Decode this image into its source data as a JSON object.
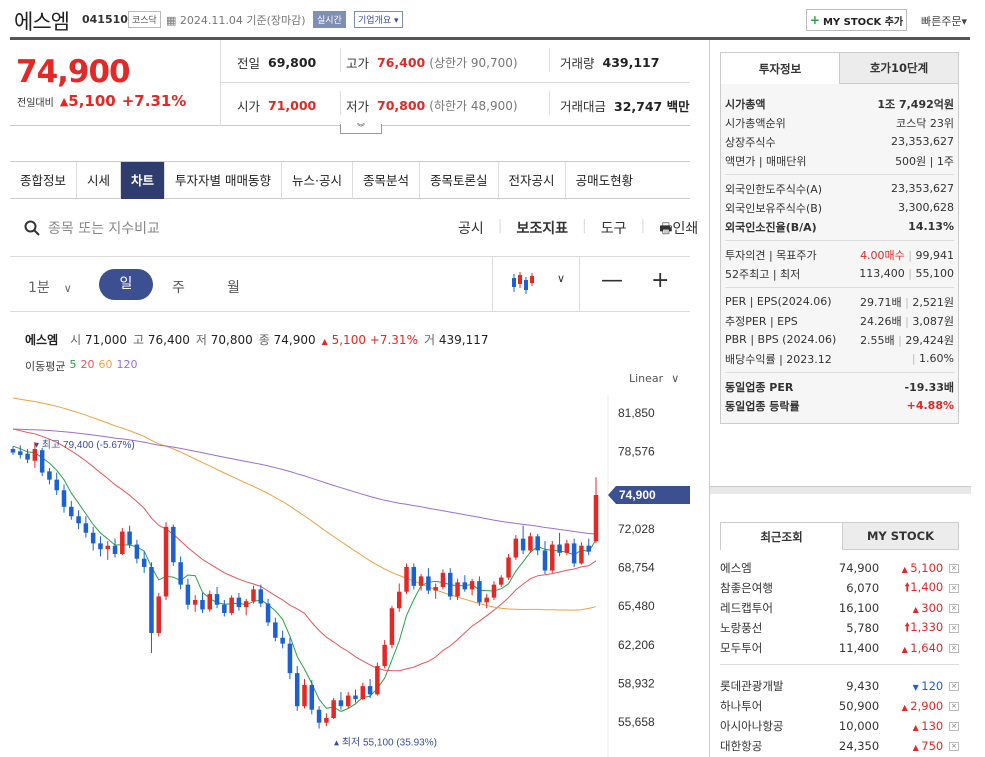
{
  "header": {
    "title": "에스엠",
    "code": "041510",
    "market": "코스닥",
    "date": "2024.11.04",
    "basis": "기준(장마감)",
    "realtime": "실시간",
    "overview": "기업개요",
    "mystock_btn": "MY STOCK 추가",
    "quick_order": "빠른주문"
  },
  "price": {
    "current": "74,900",
    "change_label": "전일대비",
    "change": "5,100",
    "change_pct": "+7.31%"
  },
  "quote": {
    "prev_label": "전일",
    "prev": "69,800",
    "high_label": "고가",
    "high": "76,400",
    "upper_limit": "(상한가 90,700)",
    "volume_label": "거래량",
    "volume": "439,117",
    "open_label": "시가",
    "open": "71,000",
    "low_label": "저가",
    "low": "70,800",
    "lower_limit": "(하한가 48,900)",
    "amount_label": "거래대금",
    "amount": "32,747 백만"
  },
  "tabs": [
    "종합정보",
    "시세",
    "차트",
    "투자자별 매매동향",
    "뉴스·공시",
    "종목분석",
    "종목토론실",
    "전자공시",
    "공매도현황"
  ],
  "search": {
    "placeholder": "종목 또는 지수비교"
  },
  "tools": {
    "disclosure": "공시",
    "indicator": "보조지표",
    "tool": "도구",
    "print": "인쇄"
  },
  "period": {
    "minute": "1분",
    "day": "일",
    "week": "주",
    "month": "월"
  },
  "ohlc": {
    "name": "에스엠",
    "open_l": "시",
    "open": "71,000",
    "high_l": "고",
    "high": "76,400",
    "low_l": "저",
    "low": "70,800",
    "close_l": "종",
    "close": "74,900",
    "change": "5,100",
    "pct": "+7.31%",
    "vol_l": "거",
    "vol": "439,117"
  },
  "ma": {
    "label": "이동평균",
    "p5": "5",
    "p20": "20",
    "p60": "60",
    "p120": "120",
    "c5": "#2aa14a",
    "c20": "#e8555a",
    "c60": "#f0a040",
    "c120": "#9b6fd6"
  },
  "chart_data": {
    "type": "candlestick",
    "scale": "Linear",
    "y_ticks": [
      81850,
      78576,
      75302,
      72028,
      68754,
      65480,
      62206,
      58932,
      55658
    ],
    "y_tick_labels": [
      "81,850",
      "78,576",
      "",
      "72,028",
      "68,754",
      "65,480",
      "62,206",
      "58,932",
      "55,658"
    ],
    "current_label": "74,900",
    "high_note": "최고 79,400 (-5.67%)",
    "low_note": "최저 55,100 (35.93%)",
    "candles": [
      [
        78800,
        79000,
        78300,
        78500
      ],
      [
        78600,
        79100,
        78000,
        78300
      ],
      [
        78400,
        78800,
        77600,
        77900
      ],
      [
        77800,
        79400,
        77200,
        78800
      ],
      [
        78700,
        78900,
        76500,
        76800
      ],
      [
        76900,
        77200,
        75800,
        76200
      ],
      [
        76200,
        76800,
        74900,
        75300
      ],
      [
        75300,
        75800,
        73400,
        73900
      ],
      [
        73900,
        74400,
        72800,
        73100
      ],
      [
        73100,
        73600,
        72000,
        72500
      ],
      [
        72500,
        73100,
        71300,
        71700
      ],
      [
        71700,
        72200,
        70200,
        70800
      ],
      [
        70800,
        71400,
        69700,
        70300
      ],
      [
        70300,
        71000,
        69400,
        70600
      ],
      [
        70600,
        71200,
        69600,
        69900
      ],
      [
        69900,
        72100,
        69800,
        71800
      ],
      [
        71800,
        72300,
        70400,
        70700
      ],
      [
        70700,
        71100,
        69100,
        69500
      ],
      [
        69500,
        70100,
        68300,
        68800
      ],
      [
        68800,
        69200,
        61500,
        63200
      ],
      [
        63200,
        66600,
        62900,
        66300
      ],
      [
        66300,
        72600,
        66000,
        72200
      ],
      [
        72200,
        72400,
        68900,
        69200
      ],
      [
        69200,
        69700,
        66900,
        67300
      ],
      [
        67300,
        67800,
        65200,
        65600
      ],
      [
        65600,
        66400,
        65000,
        66000
      ],
      [
        66000,
        66600,
        64900,
        65200
      ],
      [
        65200,
        66800,
        65000,
        66500
      ],
      [
        66500,
        67100,
        65300,
        65600
      ],
      [
        65600,
        66000,
        64600,
        64900
      ],
      [
        64900,
        66400,
        64700,
        66200
      ],
      [
        66200,
        66600,
        65100,
        65400
      ],
      [
        65400,
        66100,
        64700,
        65900
      ],
      [
        65900,
        67200,
        65700,
        66900
      ],
      [
        66900,
        67300,
        65400,
        65700
      ],
      [
        65700,
        66100,
        63800,
        64100
      ],
      [
        64100,
        64500,
        62500,
        62800
      ],
      [
        62800,
        63400,
        61900,
        62300
      ],
      [
        62300,
        62800,
        59300,
        59800
      ],
      [
        59800,
        60400,
        56600,
        57000
      ],
      [
        57000,
        59300,
        56800,
        58800
      ],
      [
        58800,
        59200,
        56300,
        56700
      ],
      [
        56700,
        57000,
        55100,
        55600
      ],
      [
        55600,
        56400,
        55300,
        56000
      ],
      [
        56000,
        57700,
        55900,
        57500
      ],
      [
        57500,
        58200,
        56700,
        57000
      ],
      [
        57000,
        58200,
        56800,
        57900
      ],
      [
        57900,
        58400,
        57300,
        57600
      ],
      [
        57600,
        59000,
        57500,
        58700
      ],
      [
        58700,
        59300,
        57700,
        58000
      ],
      [
        58000,
        60700,
        57900,
        60400
      ],
      [
        60400,
        62600,
        60200,
        62200
      ],
      [
        62200,
        65500,
        61900,
        65300
      ],
      [
        65300,
        67400,
        65000,
        66700
      ],
      [
        66700,
        69100,
        66500,
        68800
      ],
      [
        68800,
        69100,
        66900,
        67200
      ],
      [
        67200,
        68200,
        66800,
        68000
      ],
      [
        68000,
        68700,
        66500,
        66800
      ],
      [
        66800,
        67400,
        66100,
        67100
      ],
      [
        67100,
        68600,
        66900,
        68300
      ],
      [
        68300,
        68700,
        66000,
        66300
      ],
      [
        66300,
        67800,
        66000,
        67500
      ],
      [
        67500,
        68100,
        66700,
        66900
      ],
      [
        66900,
        67800,
        66400,
        67600
      ],
      [
        67600,
        68000,
        65500,
        65800
      ],
      [
        65800,
        66500,
        65300,
        66200
      ],
      [
        66200,
        67600,
        66000,
        67300
      ],
      [
        67300,
        68100,
        67100,
        67900
      ],
      [
        67900,
        69900,
        67700,
        69600
      ],
      [
        69600,
        71500,
        69400,
        71200
      ],
      [
        71200,
        72300,
        69900,
        70200
      ],
      [
        70200,
        71700,
        70000,
        71400
      ],
      [
        71400,
        71600,
        69800,
        70200
      ],
      [
        70200,
        71000,
        68200,
        68500
      ],
      [
        68500,
        71000,
        68300,
        70700
      ],
      [
        70700,
        71700,
        69700,
        70000
      ],
      [
        70000,
        71100,
        69800,
        70800
      ],
      [
        70800,
        71200,
        68800,
        69100
      ],
      [
        69100,
        70900,
        69000,
        70600
      ],
      [
        70600,
        71200,
        69800,
        70100
      ],
      [
        71000,
        76400,
        70800,
        74900
      ]
    ]
  },
  "info_tabs": {
    "a": "투자정보",
    "b": "호가10단계"
  },
  "info": {
    "g1": [
      {
        "k": "시가총액",
        "v": "1조 7,492억원"
      },
      {
        "k": "시가총액순위",
        "v": "코스닥 23위"
      },
      {
        "k": "상장주식수",
        "v": "23,353,627"
      },
      {
        "k": "액면가 | 매매단위",
        "v": "500원 | 1주"
      }
    ],
    "g2": [
      {
        "k": "외국인한도주식수(A)",
        "v": "23,353,627"
      },
      {
        "k": "외국인보유주식수(B)",
        "v": "3,300,628"
      },
      {
        "k": "외국인소진율(B/A)",
        "v": "14.13%"
      }
    ],
    "g3": [
      {
        "k": "투자의견 | 목표주가",
        "v1": "4.00매수",
        "v2": "99,941"
      },
      {
        "k": "52주최고 | 최저",
        "v1": "113,400",
        "v2": "55,100"
      }
    ],
    "g4": [
      {
        "k": "PER | EPS(2024.06)",
        "v1": "29.71배",
        "v2": "2,521원"
      },
      {
        "k": "추정PER | EPS",
        "v1": "24.26배",
        "v2": "3,087원"
      },
      {
        "k": "PBR | BPS (2024.06)",
        "v1": "2.55배",
        "v2": "29,424원"
      },
      {
        "k": "배당수익률 | 2023.12",
        "v1": "",
        "v2": "1.60%"
      }
    ],
    "g5": [
      {
        "k": "동일업종 PER",
        "v": "-19.33배"
      },
      {
        "k": "동일업종 등락률",
        "v": "+4.88%"
      }
    ]
  },
  "recent_tabs": {
    "a": "최근조회",
    "b": "MY STOCK"
  },
  "recent": [
    {
      "name": "에스엠",
      "price": "74,900",
      "chg": "5,100",
      "dir": "up"
    },
    {
      "name": "참좋은여행",
      "price": "6,070",
      "chg": "1,400",
      "dir": "limit"
    },
    {
      "name": "레드캡투어",
      "price": "16,100",
      "chg": "300",
      "dir": "up"
    },
    {
      "name": "노랑풍선",
      "price": "5,780",
      "chg": "1,330",
      "dir": "limit"
    },
    {
      "name": "모두투어",
      "price": "11,400",
      "chg": "1,640",
      "dir": "up"
    }
  ],
  "recent2": [
    {
      "name": "롯데관광개발",
      "price": "9,430",
      "chg": "120",
      "dir": "down"
    },
    {
      "name": "하나투어",
      "price": "50,900",
      "chg": "2,900",
      "dir": "up"
    },
    {
      "name": "아시아나항공",
      "price": "10,000",
      "chg": "130",
      "dir": "up"
    },
    {
      "name": "대한항공",
      "price": "24,350",
      "chg": "750",
      "dir": "up"
    }
  ]
}
